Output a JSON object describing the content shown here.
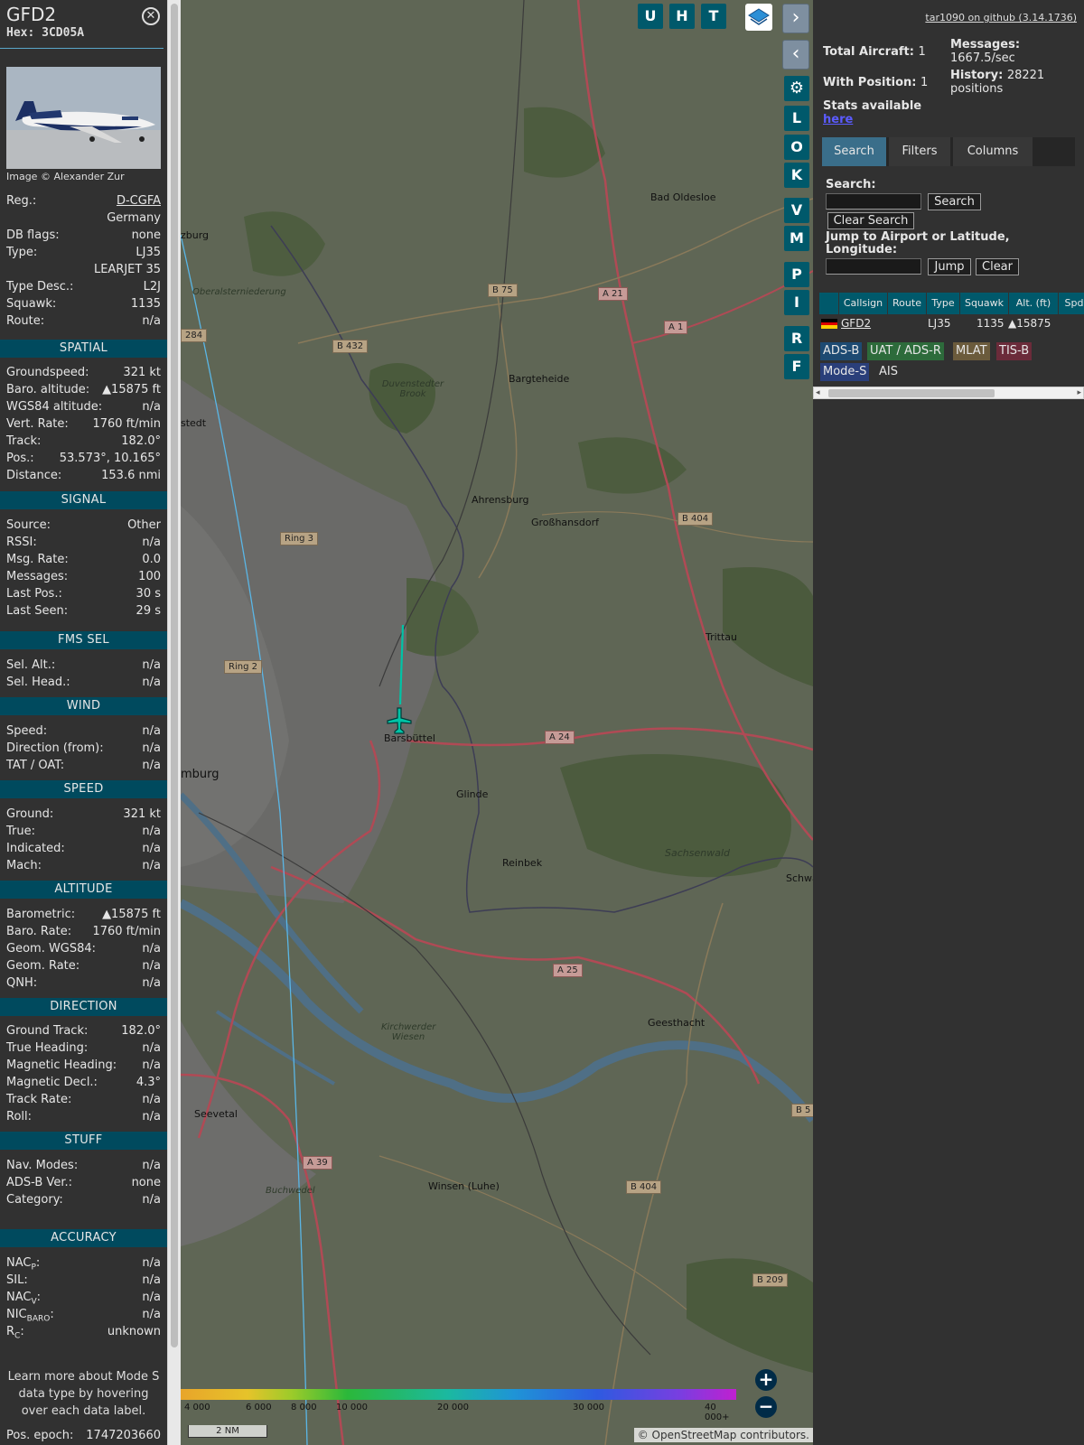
{
  "aircraft": {
    "callsign": "GFD2",
    "hex_label": "Hex:",
    "hex": "3CD05A",
    "photo_credit": "Image © Alexander Zur"
  },
  "info_rows": [
    {
      "k": "Reg.:",
      "v": "D-CGFA",
      "link": true
    },
    {
      "k": "",
      "v": "Germany"
    },
    {
      "k": "DB flags:",
      "v": "none"
    },
    {
      "k": "Type:",
      "v": "LJ35"
    },
    {
      "k": "",
      "v": "LEARJET 35"
    },
    {
      "k": "Type Desc.:",
      "v": "L2J"
    },
    {
      "k": "Squawk:",
      "v": "1135"
    },
    {
      "k": "Route:",
      "v": "n/a"
    }
  ],
  "sections": {
    "spatial": {
      "title": "SPATIAL",
      "rows": [
        {
          "k": "Groundspeed:",
          "v": "321 kt"
        },
        {
          "k": "Baro. altitude:",
          "v": "▲15875 ft"
        },
        {
          "k": "WGS84 altitude:",
          "v": "n/a"
        },
        {
          "k": "Vert. Rate:",
          "v": "1760 ft/min"
        },
        {
          "k": "Track:",
          "v": "182.0°"
        },
        {
          "k": "Pos.:",
          "v": "53.573°, 10.165°"
        },
        {
          "k": "Distance:",
          "v": "153.6 nmi"
        }
      ]
    },
    "signal": {
      "title": "SIGNAL",
      "rows": [
        {
          "k": "Source:",
          "v": "Other"
        },
        {
          "k": "RSSI:",
          "v": "n/a"
        },
        {
          "k": "Msg. Rate:",
          "v": "0.0"
        },
        {
          "k": "Messages:",
          "v": "100"
        },
        {
          "k": "Last Pos.:",
          "v": "30 s"
        },
        {
          "k": "Last Seen:",
          "v": "29 s"
        }
      ]
    },
    "fms": {
      "title": "FMS SEL",
      "rows": [
        {
          "k": "Sel. Alt.:",
          "v": "n/a"
        },
        {
          "k": "Sel. Head.:",
          "v": "n/a"
        }
      ]
    },
    "wind": {
      "title": "WIND",
      "rows": [
        {
          "k": "Speed:",
          "v": "n/a"
        },
        {
          "k": "Direction (from):",
          "v": "n/a"
        },
        {
          "k": "TAT / OAT:",
          "v": "n/a"
        }
      ]
    },
    "speed": {
      "title": "SPEED",
      "rows": [
        {
          "k": "Ground:",
          "v": "321 kt"
        },
        {
          "k": "True:",
          "v": "n/a"
        },
        {
          "k": "Indicated:",
          "v": "n/a"
        },
        {
          "k": "Mach:",
          "v": "n/a"
        }
      ]
    },
    "altitude": {
      "title": "ALTITUDE",
      "rows": [
        {
          "k": "Barometric:",
          "v": "▲15875 ft"
        },
        {
          "k": "Baro. Rate:",
          "v": "1760 ft/min"
        },
        {
          "k": "Geom. WGS84:",
          "v": "n/a"
        },
        {
          "k": "Geom. Rate:",
          "v": "n/a"
        },
        {
          "k": "QNH:",
          "v": "n/a"
        }
      ]
    },
    "direction": {
      "title": "DIRECTION",
      "rows": [
        {
          "k": "Ground Track:",
          "v": "182.0°"
        },
        {
          "k": "True Heading:",
          "v": "n/a"
        },
        {
          "k": "Magnetic Heading:",
          "v": "n/a"
        },
        {
          "k": "Magnetic Decl.:",
          "v": "4.3°"
        },
        {
          "k": "Track Rate:",
          "v": "n/a"
        },
        {
          "k": "Roll:",
          "v": "n/a"
        }
      ]
    },
    "stuff": {
      "title": "STUFF",
      "rows": [
        {
          "k": "Nav. Modes:",
          "v": "n/a"
        },
        {
          "k": "ADS-B Ver.:",
          "v": "none"
        },
        {
          "k": "Category:",
          "v": "n/a"
        }
      ]
    },
    "accuracy": {
      "title": "ACCURACY",
      "rows": [
        {
          "k": "NAC",
          "sub": "P",
          "v": "n/a"
        },
        {
          "k": "SIL:",
          "v": "n/a"
        },
        {
          "k": "NAC",
          "sub": "V",
          "v": "n/a"
        },
        {
          "k": "NIC",
          "sub": "BARO",
          "v": "n/a"
        },
        {
          "k": "R",
          "sub": "C",
          "v": "unknown"
        }
      ]
    }
  },
  "learn_more": "Learn more about Mode S data type by hovering over each data label.",
  "pos_epoch": {
    "k": "Pos. epoch:",
    "v": "1747203660"
  },
  "map": {
    "buttons": [
      "U",
      "H",
      "T"
    ],
    "side_buttons": [
      "L",
      "O",
      "K",
      "V",
      "M",
      "P",
      "I",
      "R",
      "F"
    ],
    "places": [
      {
        "t": "Bad Oldesloe"
      },
      {
        "t": "Bargteheide"
      },
      {
        "t": "Ahrensburg"
      },
      {
        "t": "Großhansdorf"
      },
      {
        "t": "Trittau"
      },
      {
        "t": "Barsbüttel"
      },
      {
        "t": "Glinde"
      },
      {
        "t": "Reinbek"
      },
      {
        "t": "Geesthacht"
      },
      {
        "t": "Seevetal"
      },
      {
        "t": "Winsen (Luhe)"
      },
      {
        "t": "mburg"
      },
      {
        "t": "zburg"
      },
      {
        "t": "stedt"
      },
      {
        "t": "Schwa"
      }
    ],
    "nature": [
      "Duvenstedter Brook",
      "Sachsenwald",
      "Kirchwerder Wiesen",
      "Buchwedel",
      "Oberalsterniederung"
    ],
    "roads": [
      "B 75",
      "A 21",
      "A 1",
      "B 432",
      "B 404",
      "Ring 3",
      "Ring 2",
      "A 24",
      "A 25",
      "B 5",
      "A 39",
      "B 404",
      "B 209",
      "284"
    ],
    "alt_scale": [
      "4 000",
      "6 000",
      "8 000",
      "10 000",
      "20 000",
      "30 000",
      "40 000+"
    ],
    "scale_bar": "2 NM",
    "attribution_prefix": "© ",
    "attribution_link": "OpenStreetMap",
    "attribution_suffix": " contributors."
  },
  "right": {
    "github": "tar1090 on github (3.14.1736)",
    "total_aircraft_label": "Total Aircraft:",
    "total_aircraft": "1",
    "with_position_label": "With Position:",
    "with_position": "1",
    "messages_label": "Messages:",
    "messages": "1667.5/sec",
    "history_label": "History:",
    "history": "28221 positions",
    "stats_label": "Stats available",
    "stats_link": "here",
    "tabs": [
      "Search",
      "Filters",
      "Columns"
    ],
    "search_label": "Search:",
    "search_btn": "Search",
    "clear_search_btn": "Clear Search",
    "jump_label": "Jump to Airport or Latitude, Longitude:",
    "jump_btn": "Jump",
    "clear_btn": "Clear",
    "table_headers": [
      "Callsign",
      "Route",
      "Type",
      "Squawk",
      "Alt. (ft)",
      "Spd"
    ],
    "table_row": {
      "callsign": "GFD2",
      "route": "",
      "type": "LJ35",
      "squawk": "1135",
      "alt": "▲15875"
    },
    "legend": [
      "ADS-B",
      "UAT / ADS-R",
      "MLAT",
      "TIS-B",
      "Mode-S",
      "AIS"
    ]
  },
  "colors": {
    "accent": "#00596b",
    "section": "#004a5e",
    "trail": "#00c3a6",
    "panel": "#313131"
  }
}
